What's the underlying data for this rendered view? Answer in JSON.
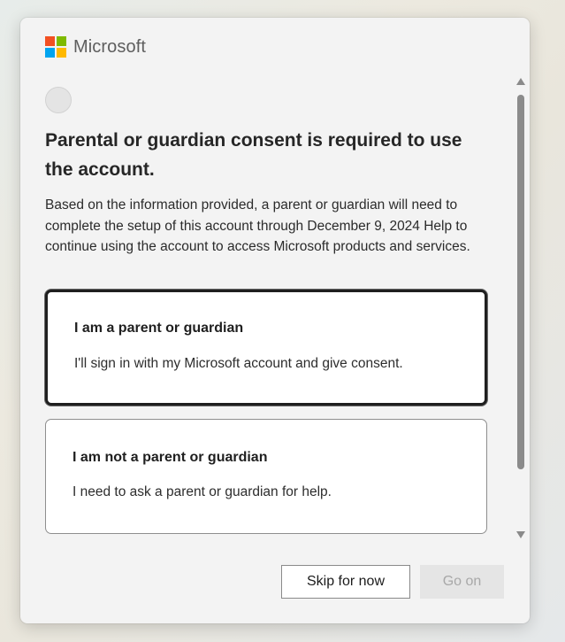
{
  "brand": {
    "name": "Microsoft",
    "logo_colors": [
      "#f25022",
      "#7fba00",
      "#00a4ef",
      "#ffb900"
    ]
  },
  "header": {
    "title": "Parental or guardian consent is required to use the account.",
    "description": "Based on the information provided, a parent or guardian will need to complete the setup of this account through December 9, 2024 Help to continue using the account to access Microsoft products and services."
  },
  "options": [
    {
      "title": "I am a parent or guardian",
      "description": "I'll sign in with my Microsoft account and give consent.",
      "selected": true
    },
    {
      "title": "I am not a parent or guardian",
      "description": "I need to ask a parent or guardian for help.",
      "selected": false
    }
  ],
  "actions": {
    "skip_label": "Skip for now",
    "continue_label": "Go on",
    "continue_enabled": false
  }
}
